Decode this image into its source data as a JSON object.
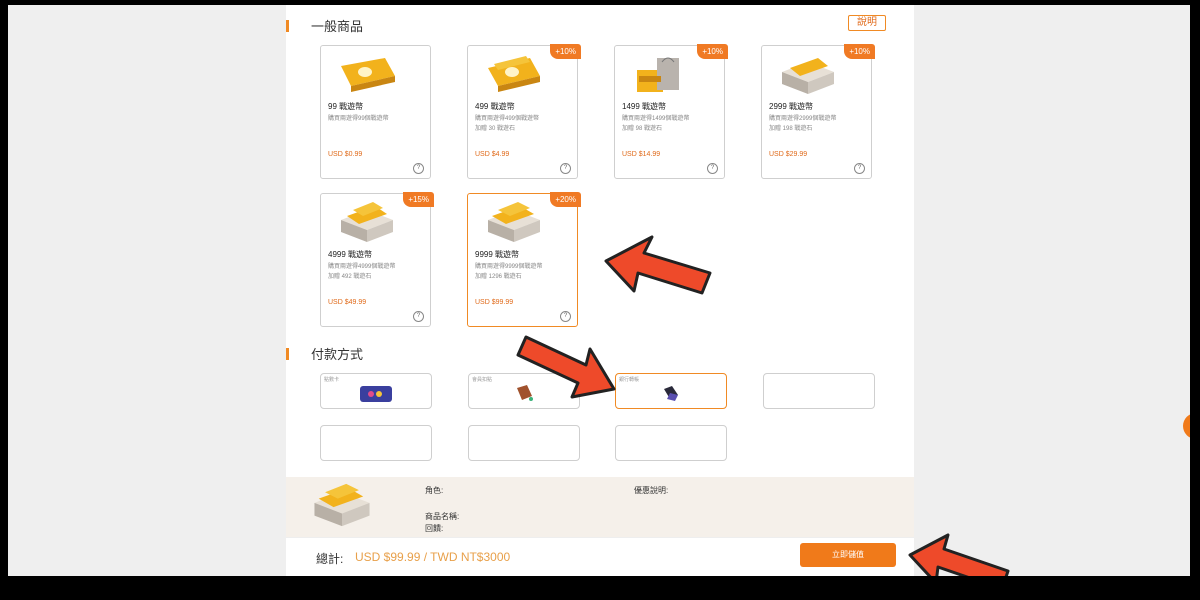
{
  "sections": {
    "general_title": "一般商品",
    "help_label": "說明",
    "payment_title": "付款方式"
  },
  "products": [
    {
      "title": "99 戰遊幣",
      "desc1": "購買兩遊得99個戰遊幣",
      "desc2": "",
      "price": "USD $0.99",
      "badge": ""
    },
    {
      "title": "499 戰遊幣",
      "desc1": "購買兩遊得499個戰遊幣",
      "desc2": "加贈 30 戰遊石",
      "price": "USD $4.99",
      "badge": "+10%"
    },
    {
      "title": "1499 戰遊幣",
      "desc1": "購買兩遊得1499個戰遊幣",
      "desc2": "加贈 98 戰遊石",
      "price": "USD $14.99",
      "badge": "+10%"
    },
    {
      "title": "2999 戰遊幣",
      "desc1": "購買兩遊得2999個戰遊幣",
      "desc2": "加贈 198 戰遊石",
      "price": "USD $29.99",
      "badge": "+10%"
    },
    {
      "title": "4999 戰遊幣",
      "desc1": "購買兩遊得4999個戰遊幣",
      "desc2": "加贈 492 戰遊石",
      "price": "USD $49.99",
      "badge": "+15%"
    },
    {
      "title": "9999 戰遊幣",
      "desc1": "購買兩遊得9999個戰遊幣",
      "desc2": "加贈 1296 戰遊石",
      "price": "USD $99.99",
      "badge": "+20%"
    }
  ],
  "help_mark": "?",
  "payments": [
    {
      "label": "點數卡"
    },
    {
      "label": "會員扣點"
    },
    {
      "label": "銀行轉帳"
    },
    {
      "label": ""
    },
    {
      "label": ""
    },
    {
      "label": ""
    },
    {
      "label": ""
    }
  ],
  "summary": {
    "role_label": "角色:",
    "discount_label": "優惠說明:",
    "product_label": "商品名稱:",
    "bonus_label": "回饋:"
  },
  "total": {
    "label": "總計:",
    "value": "USD $99.99 / TWD NT$3000",
    "buy_label": "立即儲值"
  },
  "side_tab_glyph": "«",
  "colors": {
    "accent": "#f07a1a",
    "arrow": "#ee4a2a"
  }
}
